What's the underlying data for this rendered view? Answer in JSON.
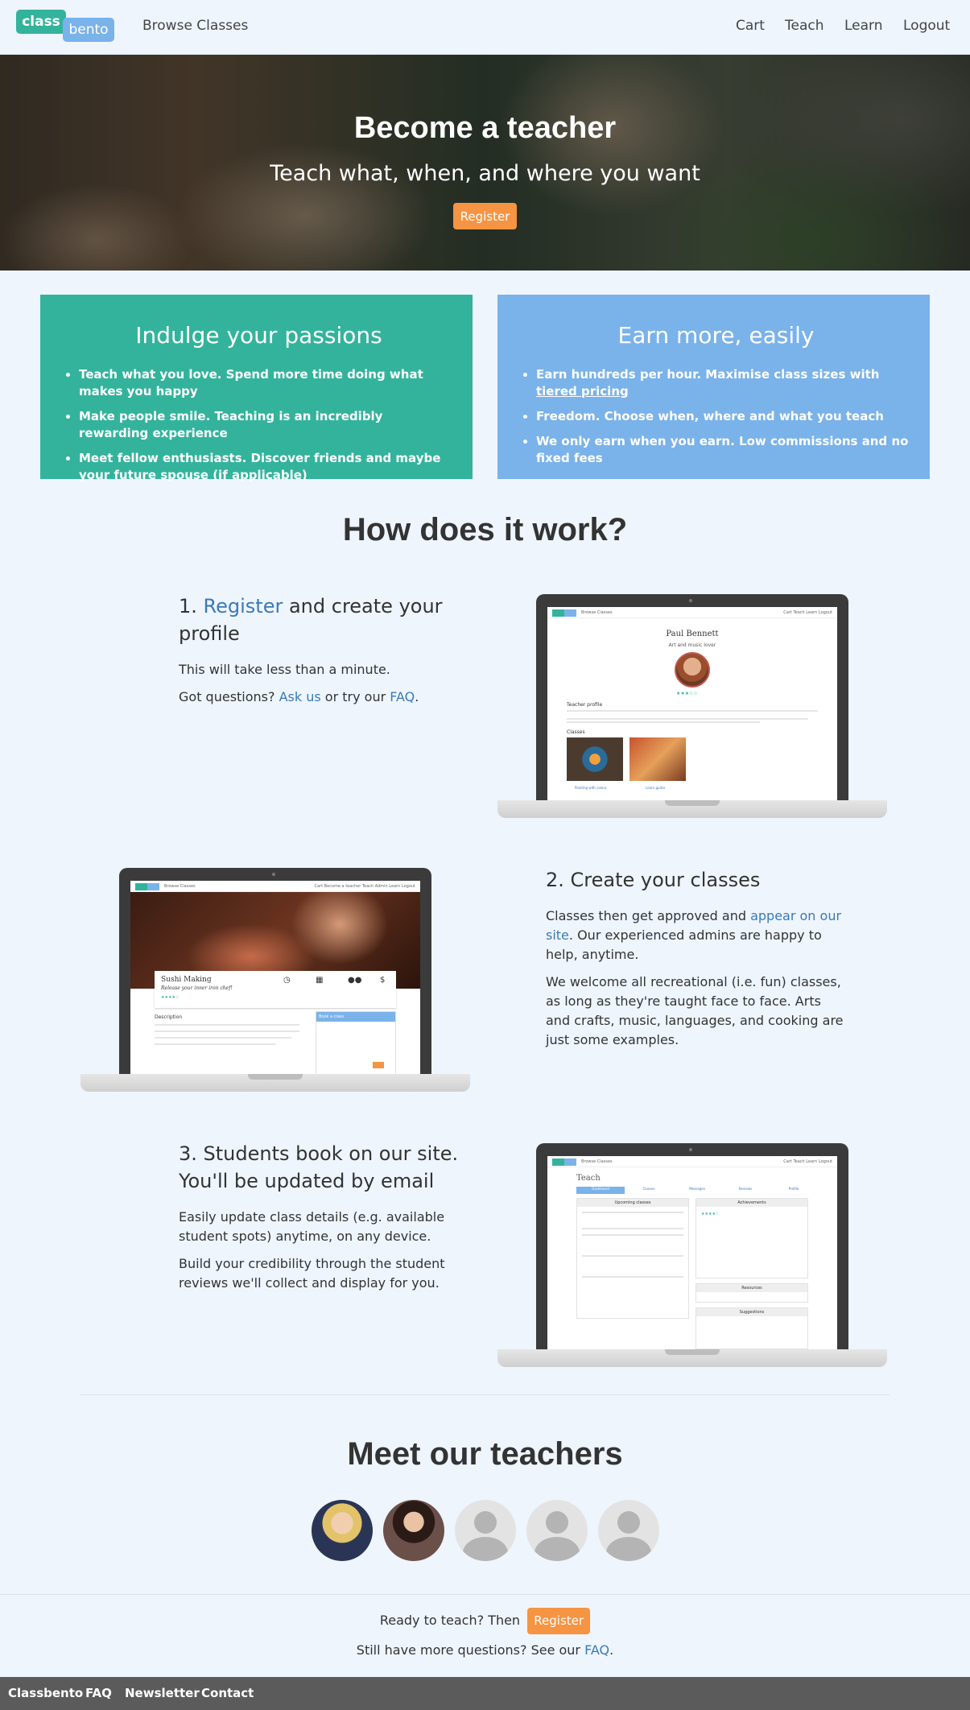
{
  "nav": {
    "logo_class": "class",
    "logo_bento": "bento",
    "browse": "Browse Classes",
    "cart": "Cart",
    "teach": "Teach",
    "learn": "Learn",
    "logout": "Logout"
  },
  "hero": {
    "title": "Become a teacher",
    "subtitle": "Teach what, when, and where you want",
    "register": "Register"
  },
  "passions": {
    "title": "Indulge your passions",
    "items": [
      "Teach what you love. Spend more time doing what makes you happy",
      "Make people smile. Teaching is an incredibly rewarding experience",
      "Meet fellow enthusiasts. Discover friends and maybe your future spouse (if applicable)"
    ]
  },
  "earn": {
    "title": "Earn more, easily",
    "item1_text": "Earn hundreds per hour. Maximise class sizes with ",
    "item1_link": "tiered pricing",
    "item2": "Freedom. Choose when, where and what you teach",
    "item3": "We only earn when you earn. Low commissions and no fixed fees"
  },
  "how": {
    "title": "How does it work?",
    "step1": {
      "num": "1. ",
      "link": "Register",
      "rest": " and create your profile",
      "p1": "This will take less than a minute.",
      "p2_a": "Got questions? ",
      "p2_ask": "Ask us",
      "p2_b": " or try our ",
      "p2_faq": "FAQ",
      "p2_c": "."
    },
    "step2": {
      "title": "2. Create your classes",
      "p1_a": "Classes then get approved and ",
      "p1_link": "appear on our site",
      "p1_b": ". Our experienced admins are happy to help, anytime.",
      "p2": "We welcome all recreational (i.e. fun) classes, as long as they're taught face to face. Arts and crafts, music, languages, and cooking are just some examples."
    },
    "step3": {
      "title": "3. Students book on our site. You'll be updated by email",
      "p1": "Easily update class details (e.g. available student spots) anytime, on any device.",
      "p2": "Build your credibility through the student reviews we'll collect and display for you."
    }
  },
  "screen1": {
    "name": "Paul Bennett",
    "tagline": "Art and music lover",
    "profile_heading": "Teacher profile",
    "classes_heading": "Classes",
    "class1": "Painting with colour",
    "class2": "Learn guitar",
    "nav_browse": "Browse Classes",
    "nav_right": "Cart  Teach  Learn  Logout"
  },
  "screen2": {
    "class_name": "Sushi Making",
    "class_tagline": "Release your inner iron chef!",
    "desc_heading": "Description",
    "book_heading": "Book a class",
    "nav_browse": "Browse Classes",
    "nav_right": "Cart  Become a teacher  Teach  Admin  Learn  Logout"
  },
  "screen3": {
    "heading": "Teach",
    "tabs": [
      "Dashboard",
      "Classes",
      "Messages",
      "Reviews",
      "Profile"
    ],
    "upcoming": "Upcoming classes",
    "achievements": "Achievements",
    "resources": "Resources",
    "suggestions": "Suggestions",
    "nav_browse": "Browse Classes",
    "nav_right": "Cart  Teach  Learn  Logout"
  },
  "teachers": {
    "title": "Meet our teachers"
  },
  "cta": {
    "ready": "Ready to teach? Then",
    "register": "Register",
    "more_a": "Still have more questions? See our ",
    "more_faq": "FAQ",
    "more_b": "."
  },
  "footer": {
    "links": [
      "Classbento",
      "FAQ",
      "Newsletter",
      "Contact"
    ]
  },
  "colors": {
    "green": "#33b39c",
    "blue": "#7ab2ea",
    "orange": "#f59443",
    "link": "#3a7ab8",
    "footer": "#5b5b5b"
  }
}
